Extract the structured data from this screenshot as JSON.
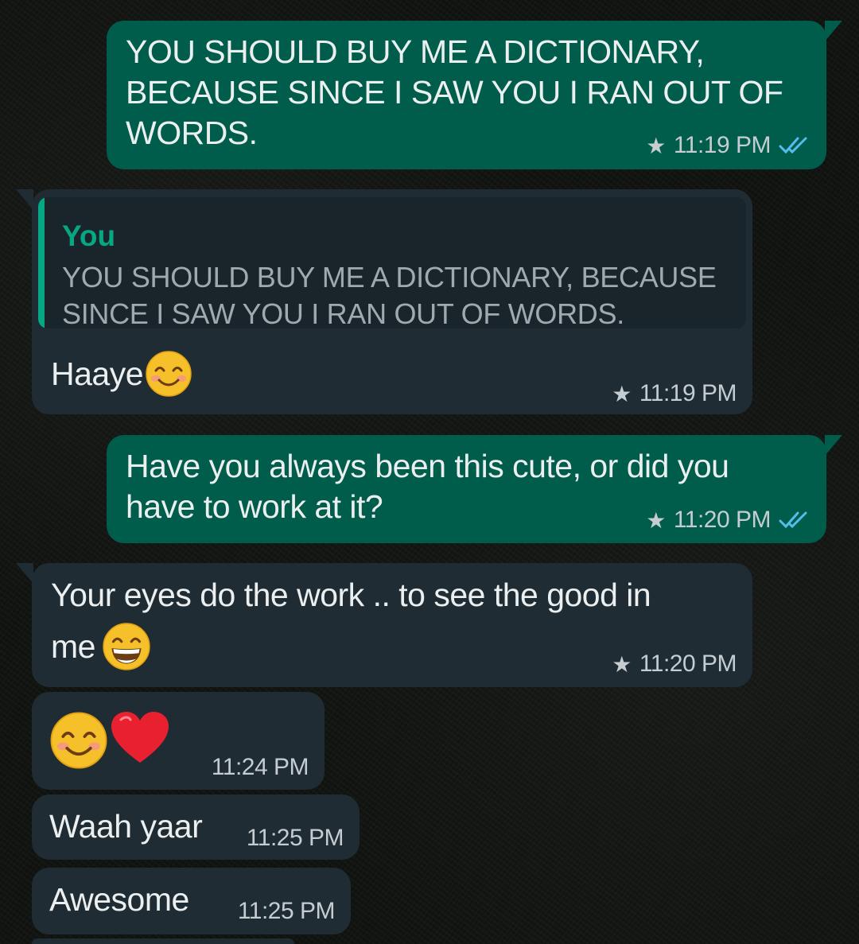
{
  "messages": [
    {
      "direction": "outgoing",
      "text": "YOU SHOULD BUY ME A DICTIONARY, BECAUSE SINCE I SAW YOU I RAN OUT OF WORDS.",
      "time": "11:19 PM",
      "starred": true,
      "status": "read"
    },
    {
      "direction": "incoming",
      "quoted": {
        "author": "You",
        "text": "YOU SHOULD BUY ME A DICTIONARY, BECAUSE SINCE I SAW YOU I RAN OUT OF WORDS."
      },
      "text": "Haaye",
      "emoji": [
        "smiling-face-with-smiling-eyes"
      ],
      "time": "11:19 PM",
      "starred": true
    },
    {
      "direction": "outgoing",
      "text": "Have you always been this cute, or did you have to work at it?",
      "time": "11:20 PM",
      "starred": true,
      "status": "read"
    },
    {
      "direction": "incoming",
      "text_line1": "Your eyes do the work .. to see the good in",
      "text_line2": "me",
      "emoji": [
        "grinning-face-with-smiling-eyes"
      ],
      "time": "11:20 PM",
      "starred": true
    },
    {
      "direction": "incoming",
      "text": "",
      "emoji": [
        "smiling-face-with-smiling-eyes",
        "red-heart"
      ],
      "time": "11:24 PM",
      "starred": false
    },
    {
      "direction": "incoming",
      "text": "Waah yaar",
      "time": "11:25 PM",
      "starred": false
    },
    {
      "direction": "incoming",
      "text": "Awesome",
      "time": "11:25 PM",
      "starred": false
    }
  ],
  "colors": {
    "outgoing_bubble": "#005c4b",
    "incoming_bubble": "#1f2c33",
    "quote_accent": "#06a884",
    "read_ticks": "#53bdeb"
  },
  "icons": {
    "star": "star-icon",
    "read_receipt": "double-check-icon"
  }
}
